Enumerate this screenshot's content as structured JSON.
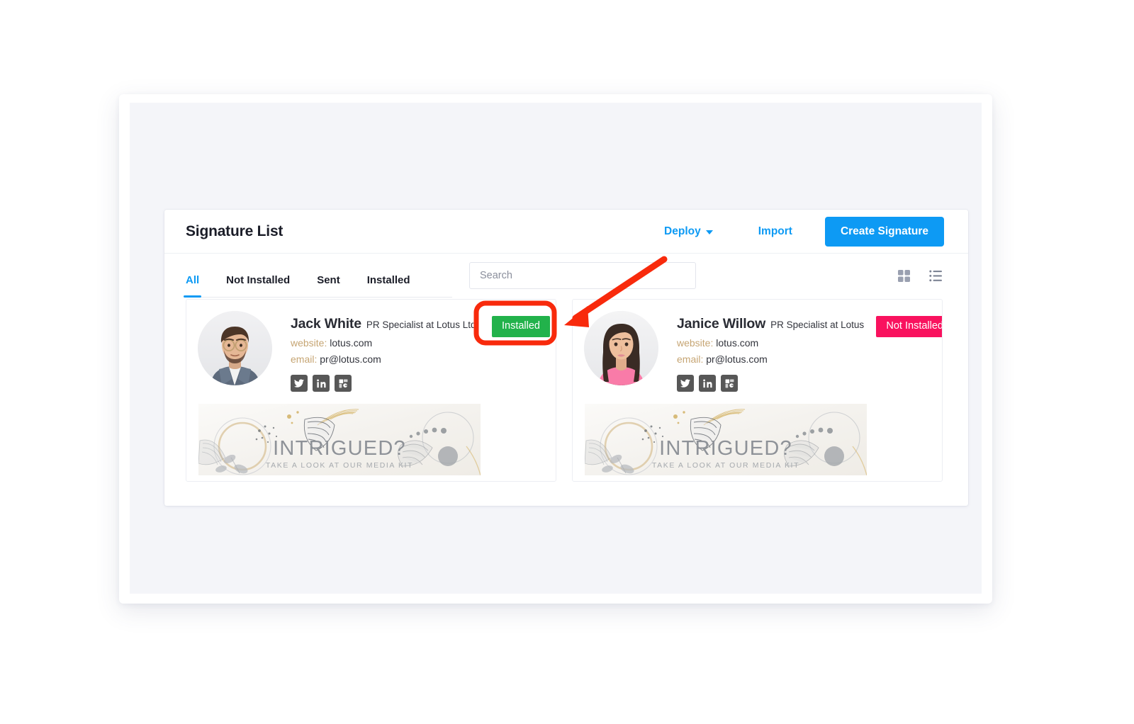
{
  "panel": {
    "title": "Signature List"
  },
  "header": {
    "deploy_label": "Deploy",
    "import_label": "Import",
    "create_label": "Create Signature",
    "accent_color": "#0d9af4"
  },
  "tabs": [
    {
      "label": "All",
      "active": true
    },
    {
      "label": "Not Installed",
      "active": false
    },
    {
      "label": "Sent",
      "active": false
    },
    {
      "label": "Installed",
      "active": false
    }
  ],
  "search": {
    "placeholder": "Search",
    "value": ""
  },
  "view_toggles": [
    {
      "name": "grid-view",
      "label": "Grid view"
    },
    {
      "name": "list-view",
      "label": "List view"
    }
  ],
  "signatures": [
    {
      "name": "Jack White",
      "role": "PR Specialist at Lotus Ltd.",
      "website_label": "website:",
      "website": "lotus.com",
      "email_label": "email:",
      "email": "pr@lotus.com",
      "status": "Installed",
      "status_color": "#22b24b",
      "socials": [
        "twitter",
        "linkedin",
        "google-business"
      ],
      "banner_title": "INTRIGUED?",
      "banner_subtitle": "TAKE A LOOK AT OUR MEDIA KIT"
    },
    {
      "name": "Janice Willow",
      "role": "PR Specialist at Lotus",
      "website_label": "website:",
      "website": "lotus.com",
      "email_label": "email:",
      "email": "pr@lotus.com",
      "status": "Not Installed",
      "status_color": "#f9125e",
      "socials": [
        "twitter",
        "linkedin",
        "google-business"
      ],
      "banner_title": "INTRIGUED?",
      "banner_subtitle": "TAKE A LOOK AT OUR MEDIA KIT"
    }
  ],
  "annotation": {
    "highlight_color": "#f82a0c",
    "target": "Installed"
  }
}
